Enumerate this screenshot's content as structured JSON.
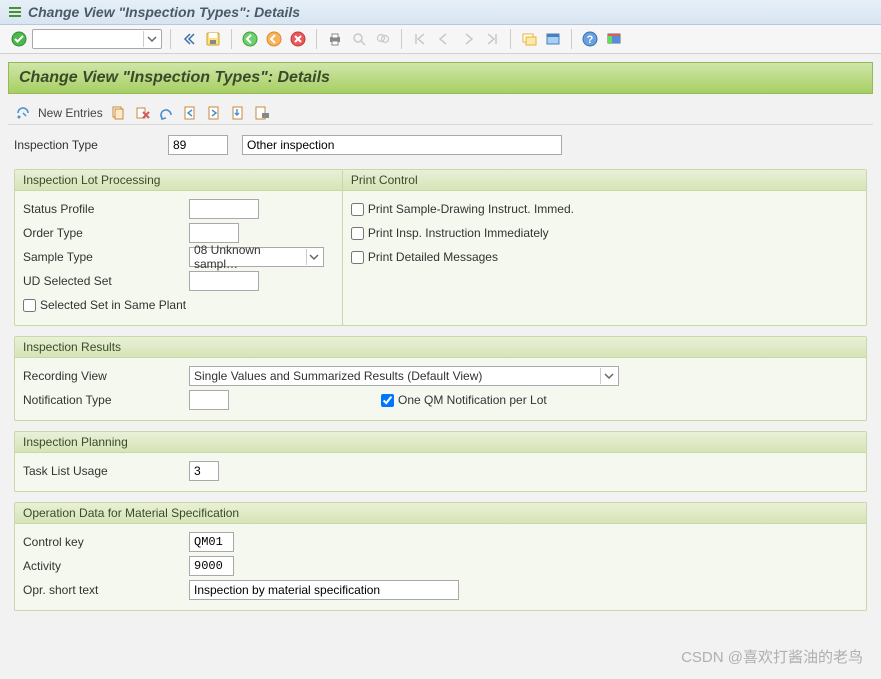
{
  "window_title": "Change View \"Inspection Types\": Details",
  "page_title": "Change View \"Inspection Types\": Details",
  "app_toolbar": {
    "new_entries": "New Entries"
  },
  "header": {
    "insp_type_label": "Inspection Type",
    "insp_type_code": "89",
    "insp_type_desc": "Other inspection"
  },
  "lot_processing": {
    "title": "Inspection Lot Processing",
    "status_profile_label": "Status Profile",
    "status_profile_value": "",
    "order_type_label": "Order Type",
    "order_type_value": "",
    "sample_type_label": "Sample Type",
    "sample_type_value": "08 Unknown sampl…",
    "ud_selected_set_label": "UD Selected Set",
    "ud_selected_set_value": "",
    "selected_set_same_plant_label": "Selected Set in Same Plant"
  },
  "print_control": {
    "title": "Print Control",
    "print_sample_drawing_label": "Print Sample-Drawing Instruct. Immed.",
    "print_insp_instruction_label": "Print Insp. Instruction Immediately",
    "print_detailed_messages_label": "Print Detailed Messages"
  },
  "inspection_results": {
    "title": "Inspection Results",
    "recording_view_label": "Recording View",
    "recording_view_value": "Single Values and Summarized Results (Default View)",
    "notification_type_label": "Notification Type",
    "notification_type_value": "",
    "one_qm_notif_label": "One QM Notification per Lot",
    "one_qm_notif_checked": true
  },
  "inspection_planning": {
    "title": "Inspection Planning",
    "task_list_usage_label": "Task List Usage",
    "task_list_usage_value": "3"
  },
  "operation_data": {
    "title": "Operation Data for Material Specification",
    "control_key_label": "Control key",
    "control_key_value": "QM01",
    "activity_label": "Activity",
    "activity_value": "9000",
    "opr_short_text_label": "Opr. short text",
    "opr_short_text_value": "Inspection by material specification"
  },
  "watermark": "CSDN @喜欢打酱油的老鸟"
}
